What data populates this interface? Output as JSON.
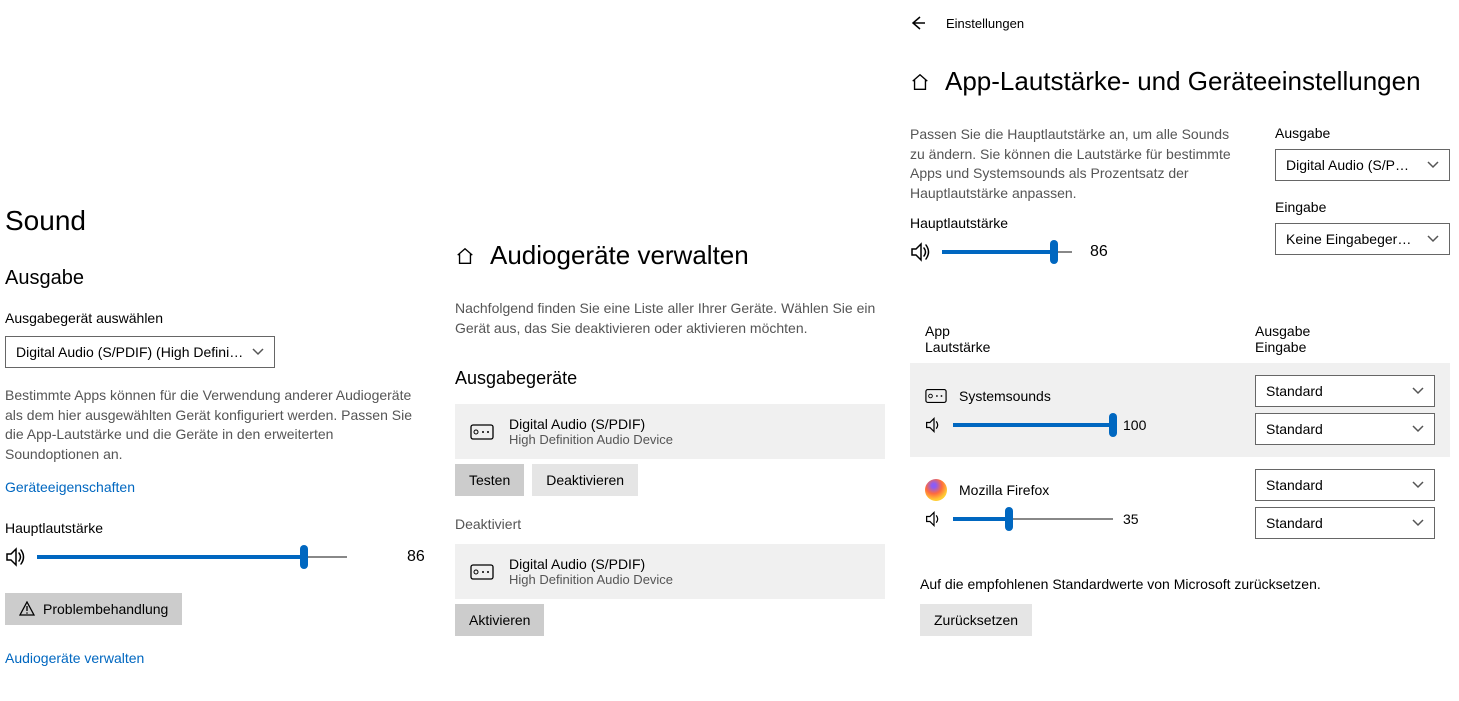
{
  "p1": {
    "title": "Sound",
    "section": "Ausgabe",
    "output_label": "Ausgabegerät auswählen",
    "output_device": "Digital Audio (S/PDIF) (High Definiti...",
    "help": "Bestimmte Apps können für die Verwendung anderer Audiogeräte als dem hier ausgewählten Gerät konfiguriert werden. Passen Sie die App-Lautstärke und die Geräte in den erweiterten Soundoptionen an.",
    "props_link": "Geräteeigenschaften",
    "master_label": "Hauptlautstärke",
    "master_value": "86",
    "master_pct": 86,
    "troubleshoot_btn": "Problembehandlung",
    "manage_link": "Audiogeräte verwalten"
  },
  "p2": {
    "title": "Audiogeräte verwalten",
    "help": "Nachfolgend finden Sie eine Liste aller Ihrer Geräte. Wählen Sie ein Gerät aus, das Sie deaktivieren oder aktivieren möchten.",
    "section": "Ausgabegeräte",
    "dev1_name": "Digital Audio (S/PDIF)",
    "dev1_sub": "High Definition Audio Device",
    "test_btn": "Testen",
    "deactivate_btn": "Deaktivieren",
    "deactivated_label": "Deaktiviert",
    "dev2_name": "Digital Audio (S/PDIF)",
    "dev2_sub": "High Definition Audio Device",
    "activate_btn": "Aktivieren"
  },
  "p3": {
    "settings_label": "Einstellungen",
    "title": "App-Lautstärke- und Geräteeinstellungen",
    "help": "Passen Sie die Hauptlautstärke an, um alle Sounds zu ändern. Sie können die Lautstärke für bestimmte Apps und Systemsounds als Prozentsatz der Hauptlautstärke anpassen.",
    "output_label": "Ausgabe",
    "output_device": "Digital Audio (S/PDI...",
    "input_label": "Eingabe",
    "input_device": "Keine Eingabegerät...",
    "master_label": "Hauptlautstärke",
    "master_value": "86",
    "master_pct": 86,
    "col_app": "App",
    "col_vol": "Lautstärke",
    "col_out": "Ausgabe",
    "col_in": "Eingabe",
    "app1_name": "Systemsounds",
    "app1_val": "100",
    "app1_pct": 100,
    "app1_out": "Standard",
    "app1_in": "Standard",
    "app2_name": "Mozilla Firefox",
    "app2_val": "35",
    "app2_pct": 35,
    "app2_out": "Standard",
    "app2_in": "Standard",
    "reset_text": "Auf die empfohlenen Standardwerte von Microsoft zurücksetzen.",
    "reset_btn": "Zurücksetzen"
  }
}
